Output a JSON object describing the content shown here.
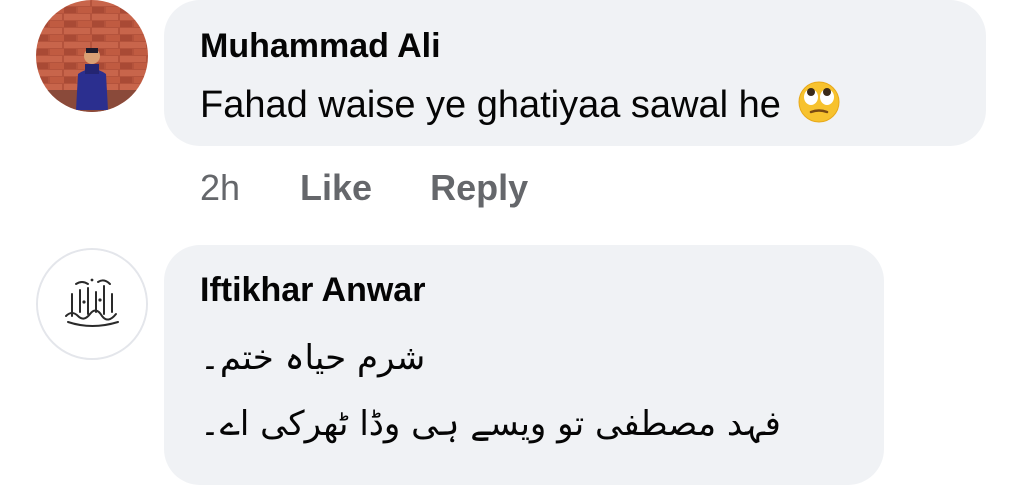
{
  "comments": [
    {
      "author": "Muhammad Ali",
      "text": "Fahad waise ye ghatiyaa sawal he",
      "emoji": "eye-roll-emoji",
      "avatar": "profile-photo-brick-wall",
      "time": "2h",
      "like_label": "Like",
      "reply_label": "Reply"
    },
    {
      "author": "Iftikhar Anwar",
      "avatar": "alhamdulillah-calligraphy-logo",
      "lines": [
        "شرم حیاہ ختم۔",
        "فہد مصطفی تو ویسے ہی وڈا ٹھرکی اے۔"
      ]
    }
  ],
  "colors": {
    "bubble": "#f0f2f5",
    "text": "#050505",
    "meta": "#65676b",
    "emoji_face": "#f7c22e"
  }
}
